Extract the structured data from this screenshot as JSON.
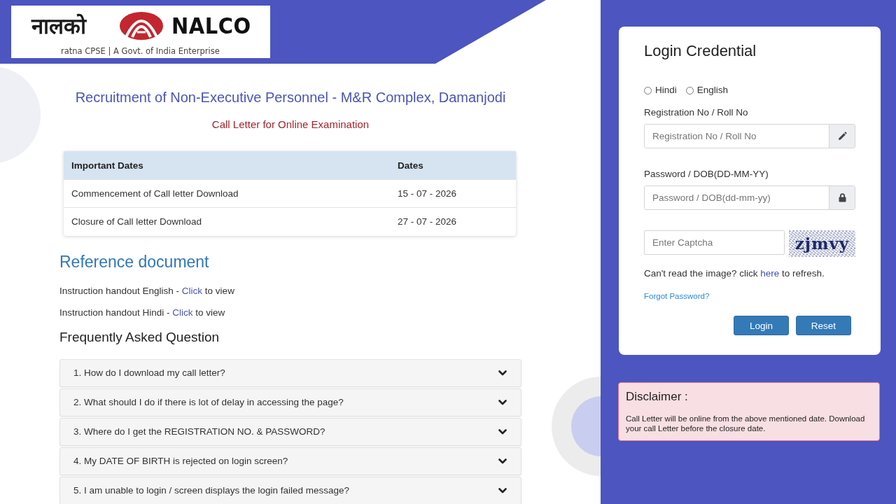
{
  "logo": {
    "hindi_name": "नालको",
    "name": "NALCO",
    "tagline": "ratna CPSE | A Govt. of India Enterprise"
  },
  "heading": "Recruitment of Non-Executive Personnel - M&R Complex, Damanjodi",
  "subheading": "Call Letter for Online Examination",
  "dates_table": {
    "columns": [
      "Important Dates",
      "Dates"
    ],
    "rows": [
      [
        "Commencement of Call letter Download",
        "15 - 07 - 2026"
      ],
      [
        "Closure of Call letter Download",
        "27 - 07 - 2026"
      ]
    ]
  },
  "reference": {
    "title": "Reference document",
    "items": [
      {
        "label": "Instruction handout English -",
        "link": "Click",
        "after": "to view"
      },
      {
        "label": "Instruction handout Hindi -",
        "link": "Click",
        "after": "to view"
      }
    ]
  },
  "faq": {
    "title": "Frequently Asked Question",
    "items": [
      {
        "question": "1. How do I download my call letter?",
        "expanded": false
      },
      {
        "question": "2. What should I do if there is lot of delay in accessing the page?",
        "expanded": false
      },
      {
        "question": "3. Where do I get the REGISTRATION NO. & PASSWORD?",
        "expanded": false
      },
      {
        "question": "4. My DATE OF BIRTH is rejected on login screen?",
        "expanded": false
      },
      {
        "question": "5. I am unable to login / screen displays the login failed message?",
        "expanded": false
      }
    ]
  },
  "login": {
    "title": "Login Credential",
    "languages": [
      {
        "label": "Hindi",
        "selected": false
      },
      {
        "label": "English",
        "selected": false
      }
    ],
    "fields": [
      {
        "label": "Registration No / Roll No",
        "placeholder": "Registration No / Roll No",
        "kind": "text"
      },
      {
        "label": "Password / DOB(DD-MM-YY)",
        "placeholder": "Password / DOB(dd-mm-yy)",
        "kind": "password"
      }
    ],
    "captcha": {
      "placeholder": "Enter Captcha",
      "code": "zjmvy"
    },
    "refresh_hint": {
      "before": "Can't read the image? click",
      "link": "here",
      "after": "to refresh."
    },
    "forgot_link": "Forgot Password?",
    "buttons": [
      "Login",
      "Reset"
    ]
  },
  "disclaimer": {
    "title": "Disclaimer :",
    "text": "Call Letter will be online from the above mentioned date. Download your call Letter before the closure date."
  }
}
